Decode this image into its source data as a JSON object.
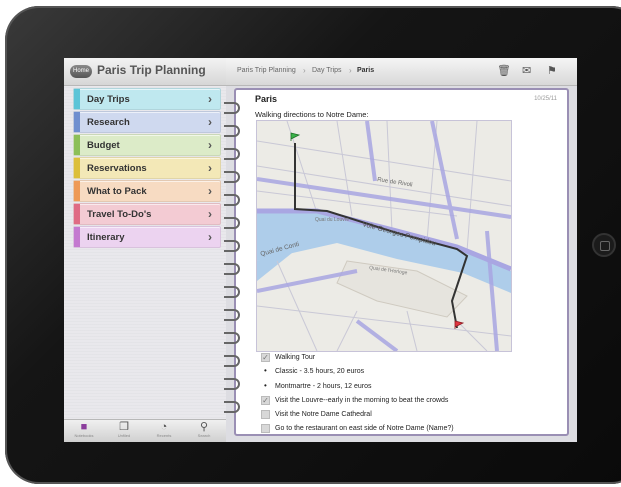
{
  "notebook": {
    "home_label": "Home",
    "title": "Paris Trip Planning"
  },
  "sections": [
    {
      "label": "Day Trips",
      "color": "#bfe8ef",
      "bar": "#5cc4d7"
    },
    {
      "label": "Research",
      "color": "#cfd9ef",
      "bar": "#6f8fcf"
    },
    {
      "label": "Budget",
      "color": "#dcebc8",
      "bar": "#8cbf58"
    },
    {
      "label": "Reservations",
      "color": "#f3e8b7",
      "bar": "#dcbf3a"
    },
    {
      "label": "What to Pack",
      "color": "#f7dbc2",
      "bar": "#ee9a57"
    },
    {
      "label": "Travel To-Do's",
      "color": "#f3cbd3",
      "bar": "#df6b84"
    },
    {
      "label": "Itinerary",
      "color": "#ecd3f0",
      "bar": "#c47ad0"
    }
  ],
  "toolbar": {
    "notebooks": "Notebooks",
    "unfiled": "Unfiled",
    "recents": "Recents",
    "search": "Search"
  },
  "breadcrumb": {
    "notebook": "Paris Trip Planning",
    "section": "Day Trips",
    "page": "Paris"
  },
  "note": {
    "title": "Paris",
    "date": "10/25/11",
    "intro": "Walking directions to Notre Dame:",
    "items": [
      {
        "kind": "checkbox",
        "checked": true,
        "text": "Walking Tour"
      },
      {
        "kind": "bullet",
        "text": "Classic - 3.5 hours, 20 euros"
      },
      {
        "kind": "bullet",
        "text": "Montmartre - 2 hours, 12 euros"
      },
      {
        "kind": "checkbox",
        "checked": true,
        "text": "Visit the Louvre--early in the morning to beat the crowds"
      },
      {
        "kind": "checkbox",
        "checked": false,
        "text": "Visit the Notre Dame Cathedral"
      },
      {
        "kind": "checkbox",
        "checked": false,
        "text": "Go to the restaurant on east side of Notre Dame (Name?)"
      }
    ]
  },
  "map": {
    "labels": {
      "quai": "Voie Georges Pompidou",
      "rivoli": "Rue de Rivoli",
      "conti": "Quai de Conti",
      "louvre": "Quai du Louvre",
      "horloge": "Quai de l'Horloge"
    }
  }
}
